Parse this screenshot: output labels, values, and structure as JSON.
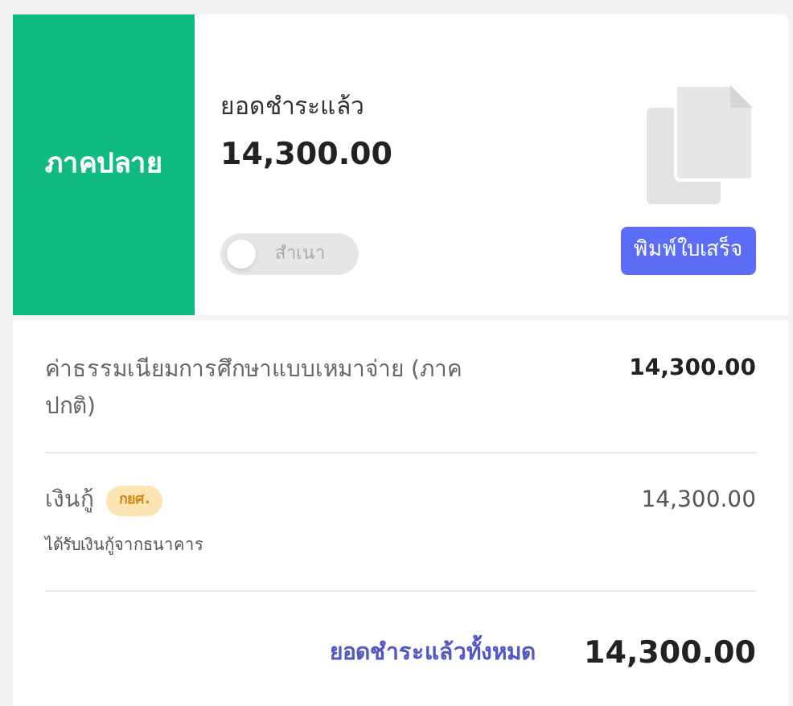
{
  "term": "ภาคปลาย",
  "paid": {
    "label": "ยอดชำระแล้ว",
    "amount": "14,300.00"
  },
  "copy_toggle": {
    "label": "สำเนา",
    "on": false
  },
  "print_button": "พิมพ์ใบเสร็จ",
  "items": [
    {
      "kind": "fee",
      "label": "ค่าธรรมเนียมการศึกษาแบบเหมาจ่าย (ภาคปกติ)",
      "amount": "14,300.00"
    },
    {
      "kind": "loan",
      "label": "เงินกู้",
      "badge": "กยศ.",
      "note": "ได้รับเงินกู้จากธนาคาร",
      "amount": "14,300.00"
    }
  ],
  "total": {
    "label": "ยอดชำระแล้วทั้งหมด",
    "amount": "14,300.00"
  }
}
